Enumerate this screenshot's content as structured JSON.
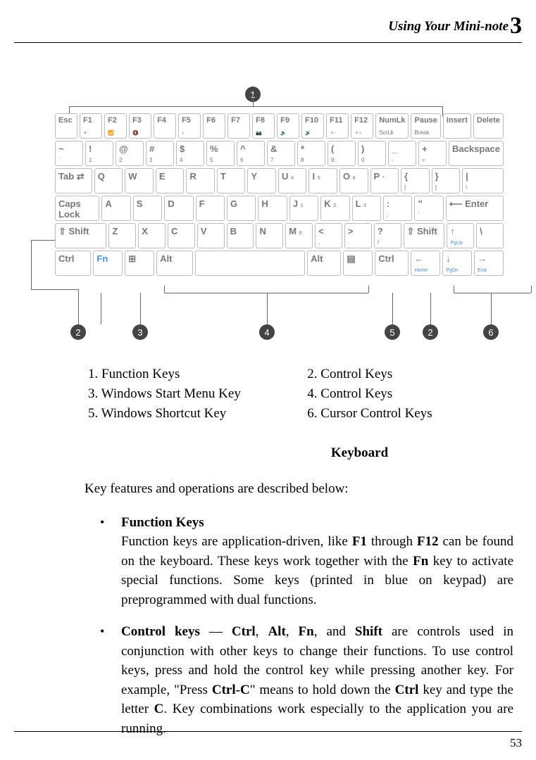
{
  "header": {
    "title": "Using Your Mini-note",
    "chapter": "3"
  },
  "callouts": [
    "1",
    "2",
    "3",
    "4",
    "5",
    "2",
    "6"
  ],
  "keyboard": {
    "row1": [
      {
        "t": "Esc"
      },
      {
        "t": "F1",
        "b": "✈"
      },
      {
        "t": "F2",
        "b": "📶"
      },
      {
        "t": "F3",
        "b": "🔇"
      },
      {
        "t": "F4",
        "b": ""
      },
      {
        "t": "F5",
        "b": "◐"
      },
      {
        "t": "F6",
        "b": ""
      },
      {
        "t": "F7",
        "b": ""
      },
      {
        "t": "F8",
        "b": "📷"
      },
      {
        "t": "F9",
        "b": "🔉"
      },
      {
        "t": "F10",
        "b": "🔊"
      },
      {
        "t": "F11",
        "b": "☀-"
      },
      {
        "t": "F12",
        "b": "☀+"
      },
      {
        "t": "NumLk",
        "s": "ScrLk"
      },
      {
        "t": "Pause",
        "s": "Break"
      },
      {
        "t": "Insert"
      },
      {
        "t": "Delete"
      }
    ],
    "row2": [
      {
        "t": "~",
        "s": "`"
      },
      {
        "t": "!",
        "s": "1"
      },
      {
        "t": "@",
        "s": "2"
      },
      {
        "t": "#",
        "s": "3"
      },
      {
        "t": "$",
        "s": "4"
      },
      {
        "t": "%",
        "s": "5"
      },
      {
        "t": "^",
        "s": "6"
      },
      {
        "t": "&",
        "s": "7"
      },
      {
        "t": "*",
        "s": "8"
      },
      {
        "t": "(",
        "s": "9"
      },
      {
        "t": ")",
        "s": "0"
      },
      {
        "t": "_",
        "s": "-"
      },
      {
        "t": "+",
        "s": "="
      },
      {
        "t": "Backspace",
        "wide": 2.1
      }
    ],
    "row3": [
      {
        "t": "Tab ⇄",
        "wide": 1.4
      },
      {
        "t": "Q"
      },
      {
        "t": "W"
      },
      {
        "t": "E"
      },
      {
        "t": "R"
      },
      {
        "t": "T"
      },
      {
        "t": "Y"
      },
      {
        "t": "U",
        "sup": "4"
      },
      {
        "t": "I",
        "sup": "5"
      },
      {
        "t": "O",
        "sup": "6"
      },
      {
        "t": "P",
        "sup": "*"
      },
      {
        "t": "{",
        "s": "["
      },
      {
        "t": "}",
        "s": "]"
      },
      {
        "t": "|",
        "s": "\\",
        "wide": 1.6
      }
    ],
    "row4": [
      {
        "t": "Caps Lock",
        "wide": 1.7
      },
      {
        "t": "A"
      },
      {
        "t": "S"
      },
      {
        "t": "D"
      },
      {
        "t": "F"
      },
      {
        "t": "G"
      },
      {
        "t": "H"
      },
      {
        "t": "J",
        "sup": "1"
      },
      {
        "t": "K",
        "sup": "2"
      },
      {
        "t": "L",
        "sup": "3"
      },
      {
        "t": ":",
        "s": ";"
      },
      {
        "t": "\"",
        "s": "'"
      },
      {
        "t": "⟵ Enter",
        "wide": 2.3
      }
    ],
    "row5": [
      {
        "t": "⇧ Shift",
        "wide": 2.2
      },
      {
        "t": "Z"
      },
      {
        "t": "X"
      },
      {
        "t": "C"
      },
      {
        "t": "V"
      },
      {
        "t": "B"
      },
      {
        "t": "N"
      },
      {
        "t": "M",
        "sup": "0"
      },
      {
        "t": "<",
        "s": ","
      },
      {
        "t": ">",
        "s": "."
      },
      {
        "t": "?",
        "s": "/"
      },
      {
        "t": "⇧ Shift",
        "wide": 1.7
      },
      {
        "t": "↑",
        "b": "PgUp",
        "blue": true
      },
      {
        "t": "\\"
      }
    ],
    "row6": [
      {
        "t": "Ctrl",
        "wide": 1.3
      },
      {
        "t": "Fn",
        "fn": true
      },
      {
        "t": "⊞"
      },
      {
        "t": "Alt",
        "wide": 1.3
      },
      {
        "t": "",
        "wide": 4.6
      },
      {
        "t": "Alt",
        "wide": 1.2
      },
      {
        "t": "▤"
      },
      {
        "t": "Ctrl",
        "wide": 1.2
      },
      {
        "t": "←",
        "b": "Home",
        "blue": true
      },
      {
        "t": "↓",
        "b": "PgDn",
        "blue": true
      },
      {
        "t": "→",
        "b": "End",
        "blue": true
      }
    ]
  },
  "legend": {
    "items": [
      "1. Function Keys",
      "2. Control Keys",
      "3. Windows Start Menu Key",
      "4. Control Keys",
      "5. Windows Shortcut Key",
      "6. Cursor Control Keys"
    ]
  },
  "figcaption": "Keyboard",
  "intro": "Key features and operations are described below:",
  "features": [
    {
      "title": "Function Keys",
      "runs": [
        {
          "t": "Function keys are application-driven, like "
        },
        {
          "t": "F1",
          "b": true
        },
        {
          "t": " through "
        },
        {
          "t": "F12",
          "b": true
        },
        {
          "t": " can be found on the keyboard. These keys work together with the "
        },
        {
          "t": "Fn",
          "b": true
        },
        {
          "t": " key to activate special functions. Some keys (printed in blue on keypad) are preprogrammed with dual functions."
        }
      ]
    },
    {
      "title": "Control keys",
      "runs": [
        {
          "t": " — "
        },
        {
          "t": "Ctrl",
          "b": true
        },
        {
          "t": ", "
        },
        {
          "t": "Alt",
          "b": true
        },
        {
          "t": ", "
        },
        {
          "t": "Fn",
          "b": true
        },
        {
          "t": ", and "
        },
        {
          "t": "Shift",
          "b": true
        },
        {
          "t": " are controls used in conjunction with other keys to change their functions. To use control keys, press and hold the control key while pressing another key. For example, \"Press "
        },
        {
          "t": "Ctrl-C",
          "b": true
        },
        {
          "t": "\" means to hold down the "
        },
        {
          "t": "Ctrl",
          "b": true
        },
        {
          "t": " key and type the letter "
        },
        {
          "t": "C",
          "b": true
        },
        {
          "t": ". Key combinations work especially to the application you are running."
        }
      ]
    }
  ],
  "pagenum": "53"
}
